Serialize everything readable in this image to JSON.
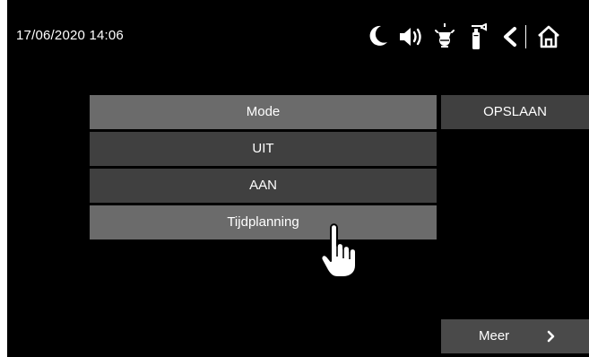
{
  "status_bar": {
    "datetime": "17/06/2020 14:06",
    "icons": [
      "moon-icon",
      "speaker-icon",
      "alarm-bell-icon",
      "fire-extinguisher-icon",
      "back-chevron-icon",
      "home-icon"
    ]
  },
  "mode_panel": {
    "header": "Mode",
    "options": [
      "UIT",
      "AAN",
      "Tijdplanning"
    ],
    "highlighted_option": "Tijdplanning"
  },
  "actions": {
    "save_label": "OPSLAAN",
    "more_label": "Meer"
  },
  "colors": {
    "background": "#000000",
    "header_bg": "#6b6b6b",
    "option_bg": "#404040",
    "highlight_bg": "#6b6b6b",
    "text": "#ffffff"
  },
  "overlay": {
    "cursor": "pointing-hand-icon"
  }
}
